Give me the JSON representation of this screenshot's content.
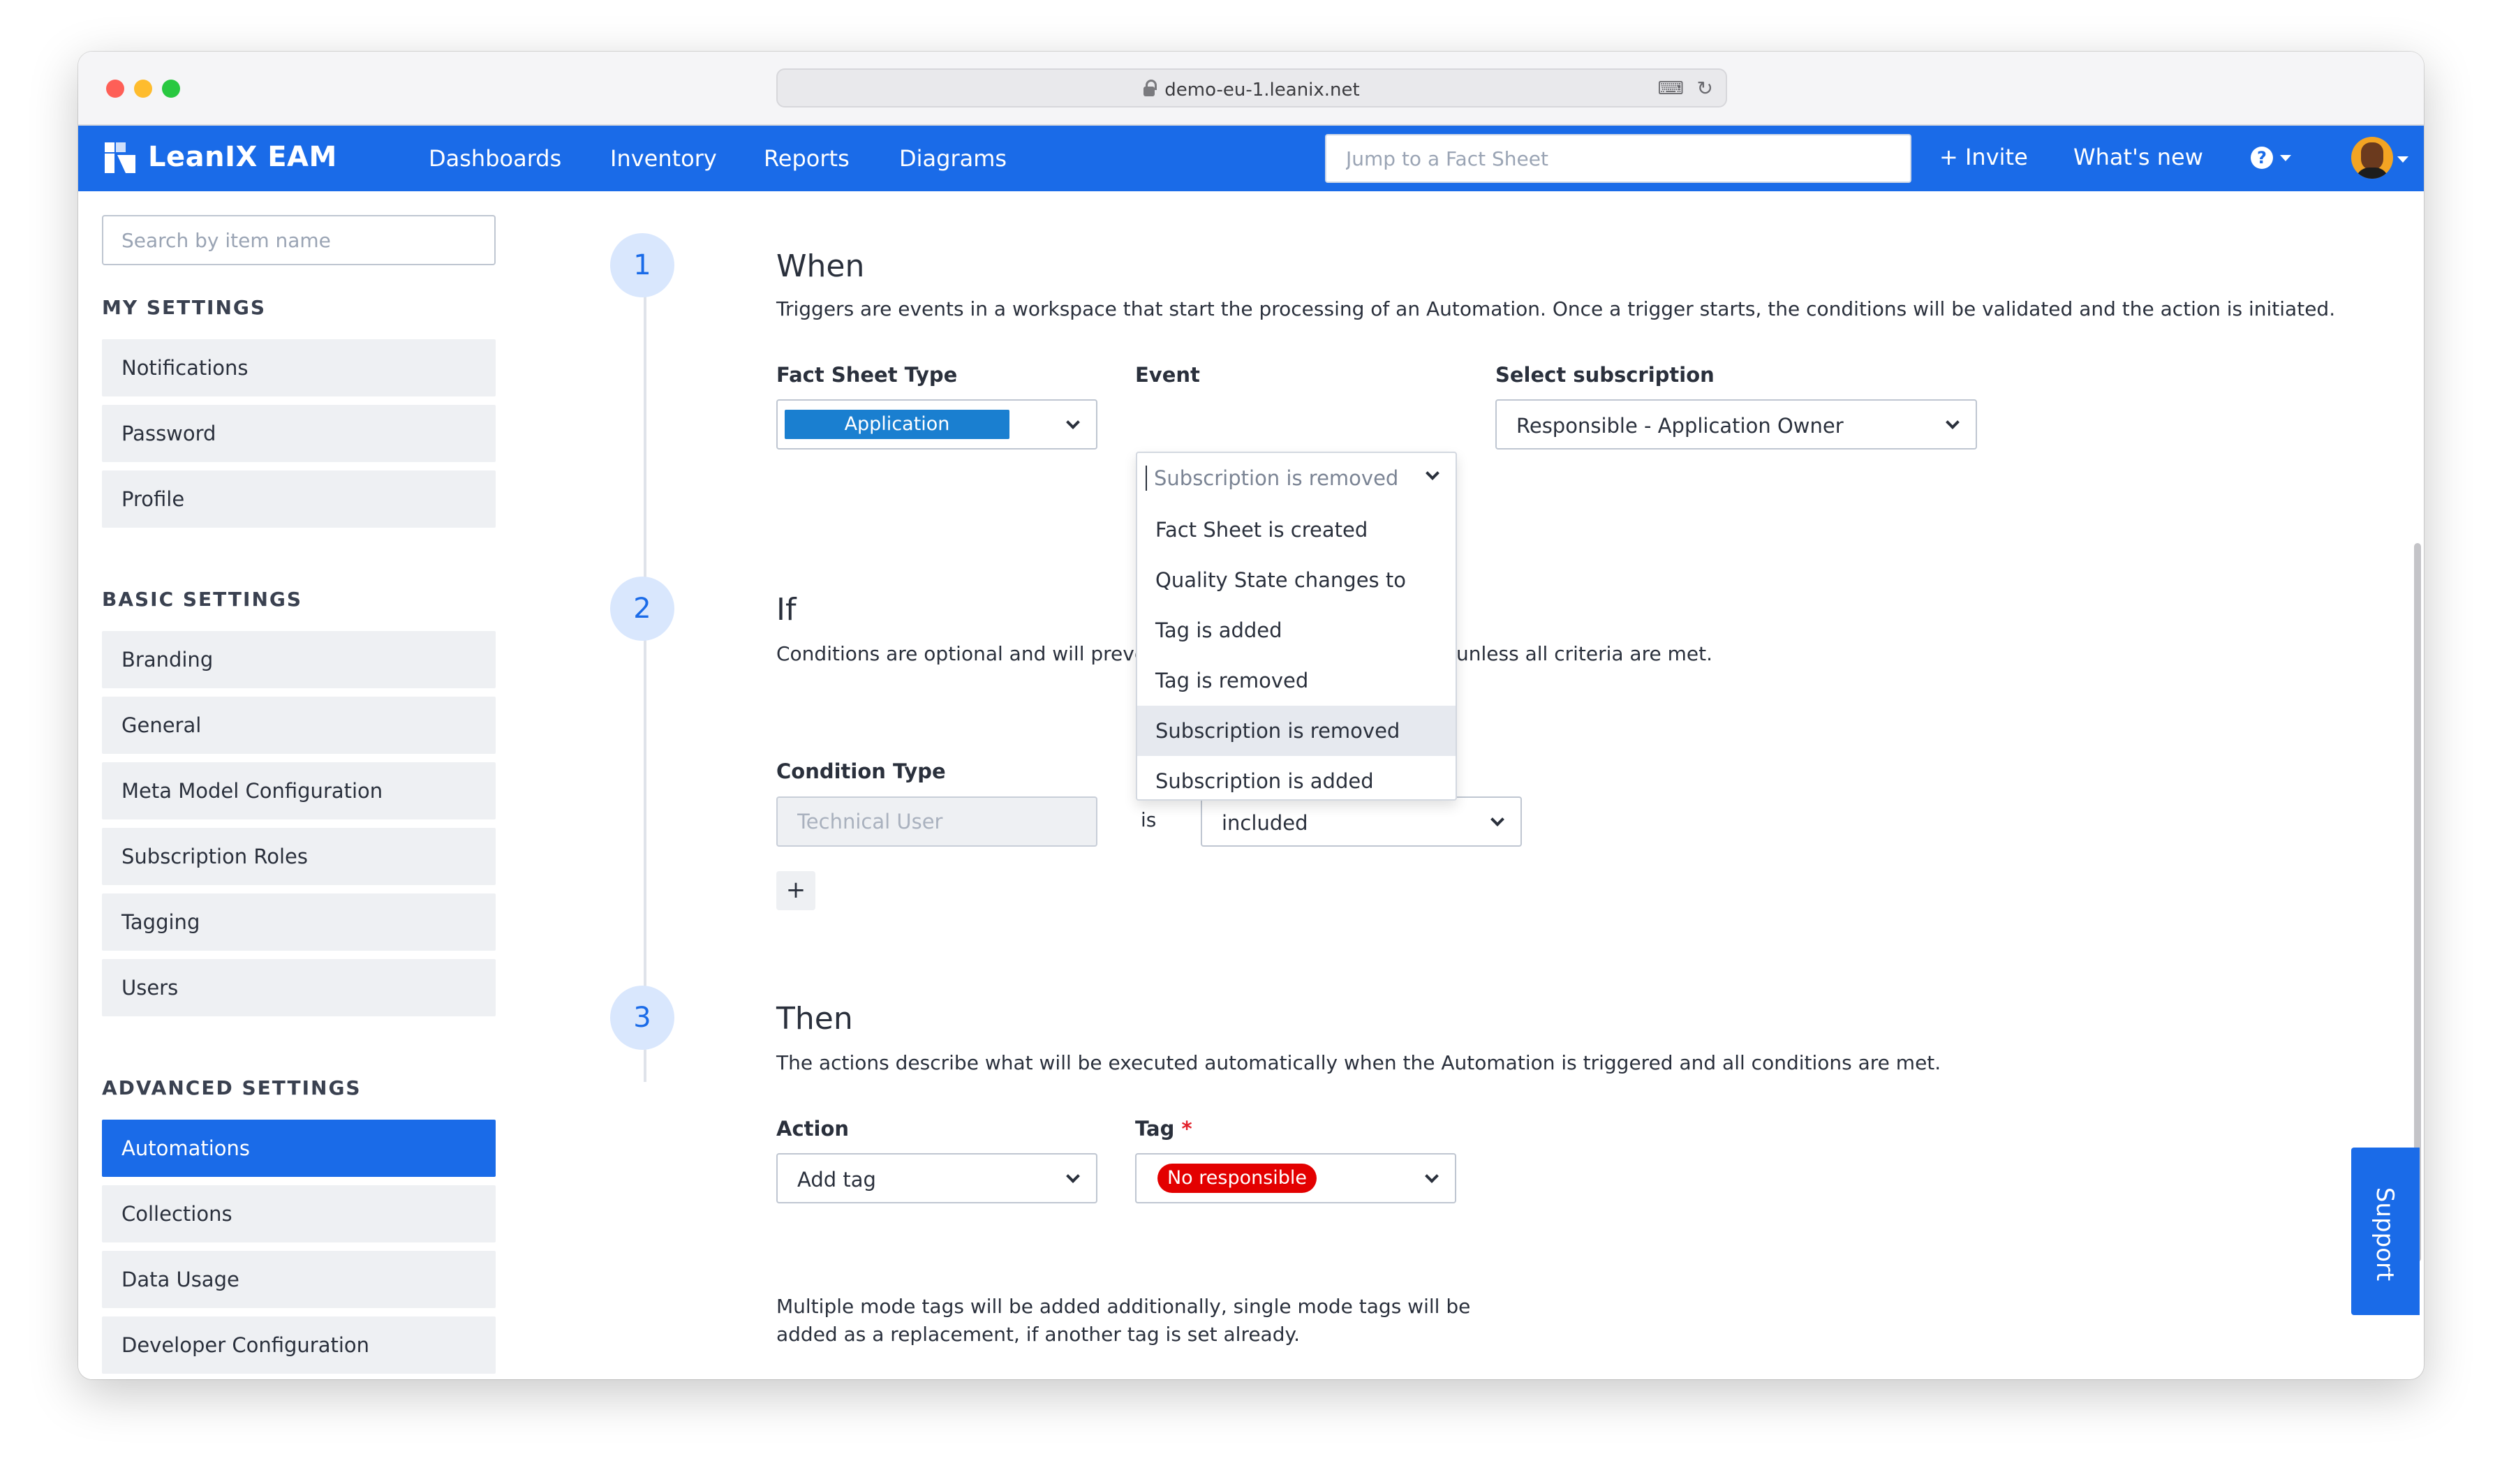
{
  "browser": {
    "url": "demo-eu-1.leanix.net"
  },
  "header": {
    "brand": "LeanIX EAM",
    "nav": [
      "Dashboards",
      "Inventory",
      "Reports",
      "Diagrams"
    ],
    "search_placeholder": "Jump to a Fact Sheet",
    "invite_label": "+ Invite",
    "whats_new_label": "What's new"
  },
  "sidebar": {
    "search_placeholder": "Search by item name",
    "sections": [
      {
        "title": "MY SETTINGS",
        "items": [
          "Notifications",
          "Password",
          "Profile"
        ]
      },
      {
        "title": "BASIC SETTINGS",
        "items": [
          "Branding",
          "General",
          "Meta Model Configuration",
          "Subscription Roles",
          "Tagging",
          "Users"
        ]
      },
      {
        "title": "ADVANCED SETTINGS",
        "items": [
          "Automations",
          "Collections",
          "Data Usage",
          "Developer Configuration"
        ]
      }
    ],
    "active_item": "Automations"
  },
  "steps": {
    "when": {
      "number": "1",
      "title": "When",
      "description": "Triggers are events in a workspace that start the processing of an Automation. Once a trigger starts, the conditions will be validated and the action is initiated.",
      "fact_sheet_type_label": "Fact Sheet Type",
      "fact_sheet_type_value": "Application",
      "event_label": "Event",
      "event_placeholder": "Subscription is removed",
      "subscription_label": "Select subscription",
      "subscription_value": "Responsible - Application Owner"
    },
    "if": {
      "number": "2",
      "title": "If",
      "description_start": "Conditions are optional and will preve",
      "description_end": "unless all criteria are met.",
      "condition_type_label": "Condition Type",
      "condition_type_placeholder": "Technical User",
      "is_text": "is",
      "included_value": "included",
      "add_label": "+"
    },
    "then": {
      "number": "3",
      "title": "Then",
      "description": "The actions describe what will be executed automatically when the Automation is triggered and all conditions are met.",
      "action_label": "Action",
      "action_value": "Add tag",
      "tag_label": "Tag",
      "tag_required": "*",
      "tag_value": "No responsible",
      "note": "Multiple mode tags will be added additionally, single mode tags will be added as a replacement, if another tag is set already."
    }
  },
  "event_dropdown": {
    "options": [
      "Fact Sheet is created",
      "Quality State changes to",
      "Tag is added",
      "Tag is removed",
      "Subscription is removed",
      "Subscription is added"
    ],
    "hovered": "Subscription is removed"
  },
  "support_label": "Support",
  "colors": {
    "primary": "#1a6be8",
    "application_chip": "#1a7fd0",
    "tag_chip": "#e30000",
    "step_circle": "#d9e7fd"
  },
  "icons": {
    "help": "question-circle-icon",
    "caret": "caret-down-icon",
    "chevron": "chevron-down-icon",
    "lock": "lock-icon",
    "reload": "reload-icon"
  }
}
